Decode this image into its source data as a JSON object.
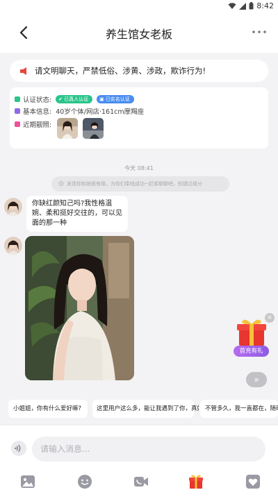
{
  "status_bar": {
    "time": "8:42"
  },
  "header": {
    "title": "养生馆女老板"
  },
  "notice": {
    "text": "请文明聊天，严禁低俗、涉黄、涉政，欺诈行为!"
  },
  "profile": {
    "verify_label": "认证状态:",
    "badge_realname": "已真人认证",
    "badge_realname_color": "#2bc48a",
    "badge_realperson": "已实名认证",
    "badge_realperson_color": "#4a8cf0",
    "basic_label": "基本信息:",
    "basic_value": "40岁个体/网店·161cm摩羯座",
    "photos_label": "近期靓照:"
  },
  "chat": {
    "timestamp": "今天 08:41",
    "system_tip": "发现你和她很有缘，为你们牵线成功~赶紧聊聊吧，别错过缘分",
    "message_1": "你缺红颜知己吗?我性格温婉、柔和挺好交往的，可以见面的那一种"
  },
  "gift_float": {
    "label": "首充有礼",
    "close": "×"
  },
  "quick_replies": [
    "小姐姐，你有什么爱好嘛?",
    "这里用户这么多，能让我遇到了你，真好",
    "不管多久，我一直都在，随时等你"
  ],
  "input": {
    "placeholder": "请输入消息..."
  },
  "icons": [
    "image-icon",
    "emoji-icon",
    "video-call-icon",
    "gift-icon",
    "heart-icon"
  ]
}
